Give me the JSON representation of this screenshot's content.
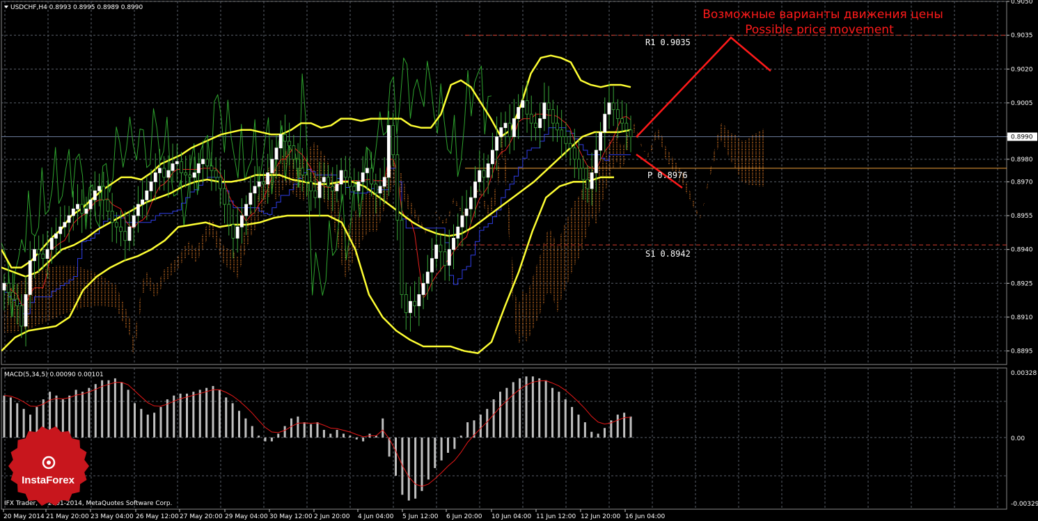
{
  "chart_header": {
    "symbol_line": "USDCHF,H4  0.8993 0.8995 0.8989 0.8990",
    "dropdown_icon": "triangle-down-icon"
  },
  "annotation": {
    "ru": "Возможные варианты движения цены",
    "en": "Possible price movement"
  },
  "levels": [
    {
      "label": "R1",
      "value": "0.9035",
      "price": 0.9035,
      "color": "#d33e2e"
    },
    {
      "label": "P",
      "value": "0.8976",
      "price": 0.8976,
      "color": "#f2a23a"
    },
    {
      "label": "S1",
      "value": "0.8942",
      "price": 0.8942,
      "color": "#d33e2e"
    }
  ],
  "current_price": {
    "label": "0.8990",
    "price": 0.899
  },
  "macd": {
    "title": "MACD(5,34,5) 0.00090 0.00101",
    "ticks": [
      "0.00328",
      "0.00",
      "-0.00329"
    ]
  },
  "footer": {
    "copyright": "IFX Trader, © 2001-2014, MetaQuotes Software Corp."
  },
  "logo": {
    "text": "InstaForex",
    "icon": "instaforex-emblem-icon"
  },
  "colors": {
    "bull": "#ffffff",
    "bear": "#000000",
    "wick": "#3aa83a",
    "bollinger": "#ffff33",
    "tenkan": "#e8201d",
    "kijun": "#2f3ee6",
    "chikou": "#2ea42e",
    "cloud": "#ff8c2a",
    "forecast": "#ff1a1a",
    "grid": "#5a5f6a",
    "macd_hist": "#c0c0c0",
    "macd_signal": "#e81818"
  },
  "chart_data": {
    "type": "candlestick",
    "symbol": "USDCHF",
    "timeframe": "H4",
    "ylim": [
      0.8889,
      0.905
    ],
    "y_ticks": [
      "0.9050",
      "0.9035",
      "0.9020",
      "0.9005",
      "0.8990",
      "0.8980",
      "0.8970",
      "0.8955",
      "0.8940",
      "0.8925",
      "0.8910",
      "0.8895"
    ],
    "y_tick_values": [
      0.905,
      0.9035,
      0.902,
      0.9005,
      0.899,
      0.898,
      0.897,
      0.8955,
      0.894,
      0.8925,
      0.891,
      0.8895
    ],
    "x_ticks": [
      "20 May 2014",
      "21 May 20:00",
      "23 May 04:00",
      "26 May 12:00",
      "27 May 20:00",
      "29 May 04:00",
      "30 May 12:00",
      "2 Jun 20:00",
      "4 Jun 04:00",
      "5 Jun 12:00",
      "6 Jun 20:00",
      "10 Jun 04:00",
      "11 Jun 12:00",
      "12 Jun 20:00",
      "16 Jun 04:00"
    ],
    "closes": [
      0.8925,
      0.8921,
      0.8918,
      0.8915,
      0.8906,
      0.892,
      0.8935,
      0.894,
      0.8938,
      0.8936,
      0.894,
      0.8945,
      0.8947,
      0.895,
      0.8952,
      0.8955,
      0.8958,
      0.896,
      0.8956,
      0.8958,
      0.8962,
      0.8966,
      0.8968,
      0.8962,
      0.8957,
      0.8952,
      0.895,
      0.8948,
      0.8944,
      0.895,
      0.8955,
      0.896,
      0.8962,
      0.8966,
      0.897,
      0.8974,
      0.8976,
      0.8972,
      0.8975,
      0.8978,
      0.8979,
      0.8974,
      0.8973,
      0.8972,
      0.8974,
      0.8978,
      0.898,
      0.8977,
      0.8975,
      0.8972,
      0.8967,
      0.896,
      0.8951,
      0.8945,
      0.895,
      0.8955,
      0.896,
      0.8965,
      0.8968,
      0.897,
      0.8969,
      0.8974,
      0.898,
      0.8985,
      0.8991,
      0.8988,
      0.8986,
      0.898,
      0.8976,
      0.8973,
      0.897,
      0.8966,
      0.8963,
      0.897,
      0.8972,
      0.8968,
      0.8966,
      0.8969,
      0.8975,
      0.8972,
      0.8968,
      0.8966,
      0.897,
      0.8974,
      0.8976,
      0.8969,
      0.8965,
      0.8968,
      0.8972,
      0.8995,
      0.8982,
      0.8953,
      0.892,
      0.8912,
      0.8917,
      0.8915,
      0.892,
      0.8925,
      0.893,
      0.8936,
      0.8942,
      0.8939,
      0.8933,
      0.894,
      0.8945,
      0.895,
      0.8955,
      0.8958,
      0.8963,
      0.897,
      0.8975,
      0.8972,
      0.8978,
      0.8984,
      0.899,
      0.8994,
      0.8996,
      0.899,
      0.8998,
      0.9003,
      0.9006,
      0.9,
      0.8996,
      0.8994,
      0.8998,
      0.9005,
      0.9002,
      0.8996,
      0.8993,
      0.899,
      0.8987,
      0.8985,
      0.898,
      0.8976,
      0.8971,
      0.8967,
      0.8974,
      0.8984,
      0.8992,
      0.9,
      0.9005,
      0.9002,
      0.8998,
      0.8996,
      0.8993,
      0.899
    ],
    "bollinger_upper": [
      0.894,
      0.8932,
      0.8932,
      0.8935,
      0.894,
      0.8945,
      0.8949,
      0.8955,
      0.8958,
      0.8962,
      0.8966,
      0.8969,
      0.8972,
      0.8972,
      0.8971,
      0.8974,
      0.8978,
      0.898,
      0.8982,
      0.8985,
      0.8987,
      0.8989,
      0.8991,
      0.8992,
      0.8993,
      0.8993,
      0.8992,
      0.8991,
      0.8991,
      0.8993,
      0.8996,
      0.8996,
      0.8994,
      0.8995,
      0.8998,
      0.8998,
      0.8997,
      0.8998,
      0.8998,
      0.8998,
      0.8998,
      0.8995,
      0.8994,
      0.8994,
      0.9,
      0.9013,
      0.9015,
      0.9012,
      0.9005,
      0.8998,
      0.899,
      0.8993,
      0.9004,
      0.9018,
      0.9025,
      0.9026,
      0.9025,
      0.9023,
      0.9015,
      0.9013,
      0.9012,
      0.9013,
      0.9013,
      0.9012
    ],
    "bollinger_middle": [
      0.8932,
      0.893,
      0.8928,
      0.893,
      0.8935,
      0.894,
      0.8942,
      0.8945,
      0.8949,
      0.8952,
      0.8955,
      0.8958,
      0.8961,
      0.8963,
      0.8965,
      0.8968,
      0.897,
      0.8971,
      0.897,
      0.897,
      0.8971,
      0.8973,
      0.8973,
      0.8973,
      0.8971,
      0.897,
      0.8969,
      0.8969,
      0.897,
      0.897,
      0.8968,
      0.8964,
      0.896,
      0.8956,
      0.8952,
      0.8949,
      0.8947,
      0.8946,
      0.8947,
      0.895,
      0.8954,
      0.8958,
      0.8962,
      0.8966,
      0.897,
      0.8975,
      0.898,
      0.8985,
      0.899,
      0.8992,
      0.8992,
      0.8992,
      0.8993
    ],
    "bollinger_lower": [
      0.8895,
      0.8901,
      0.8904,
      0.8905,
      0.8906,
      0.891,
      0.8922,
      0.8928,
      0.8932,
      0.8935,
      0.8937,
      0.894,
      0.8944,
      0.895,
      0.8951,
      0.8952,
      0.895,
      0.8951,
      0.8951,
      0.8952,
      0.8954,
      0.8955,
      0.8955,
      0.8955,
      0.8955,
      0.8952,
      0.894,
      0.892,
      0.891,
      0.8904,
      0.89,
      0.8897,
      0.8897,
      0.8897,
      0.8895,
      0.8894,
      0.8899,
      0.8915,
      0.893,
      0.8948,
      0.8963,
      0.8968,
      0.897,
      0.897,
      0.8972,
      0.8972
    ],
    "macd_hist": [
      0.0022,
      0.0021,
      0.0018,
      0.0015,
      0.0012,
      0.0016,
      0.002,
      0.0024,
      0.0022,
      0.002,
      0.0022,
      0.0025,
      0.0024,
      0.0026,
      0.0028,
      0.003,
      0.003,
      0.0031,
      0.0029,
      0.0025,
      0.0018,
      0.0015,
      0.0012,
      0.0013,
      0.0016,
      0.002,
      0.0022,
      0.0023,
      0.0023,
      0.0024,
      0.0025,
      0.0026,
      0.0027,
      0.0025,
      0.0021,
      0.0018,
      0.0014,
      0.001,
      0.0006,
      0.0001,
      -0.0002,
      -0.0002,
      0.0002,
      0.0006,
      0.001,
      0.0011,
      0.0008,
      0.0007,
      0.0008,
      0.0004,
      0.0002,
      0.0004,
      0.0002,
      0.0001,
      -0.0001,
      -0.0002,
      0.0002,
      0.0001,
      0.001,
      -0.001,
      -0.002,
      -0.003,
      -0.0033,
      -0.0032,
      -0.0028,
      -0.0022,
      -0.0016,
      -0.0012,
      -0.0008,
      -0.0006,
      0.0001,
      0.0008,
      0.0009,
      0.0012,
      0.0015,
      0.002,
      0.0024,
      0.0026,
      0.0029,
      0.0031,
      0.0032,
      0.0032,
      0.0031,
      0.003,
      0.0026,
      0.0024,
      0.002,
      0.0016,
      0.0012,
      0.0008,
      0.0003,
      0.0002,
      0.0005,
      0.0009,
      0.0012,
      0.0013,
      0.0011
    ]
  }
}
